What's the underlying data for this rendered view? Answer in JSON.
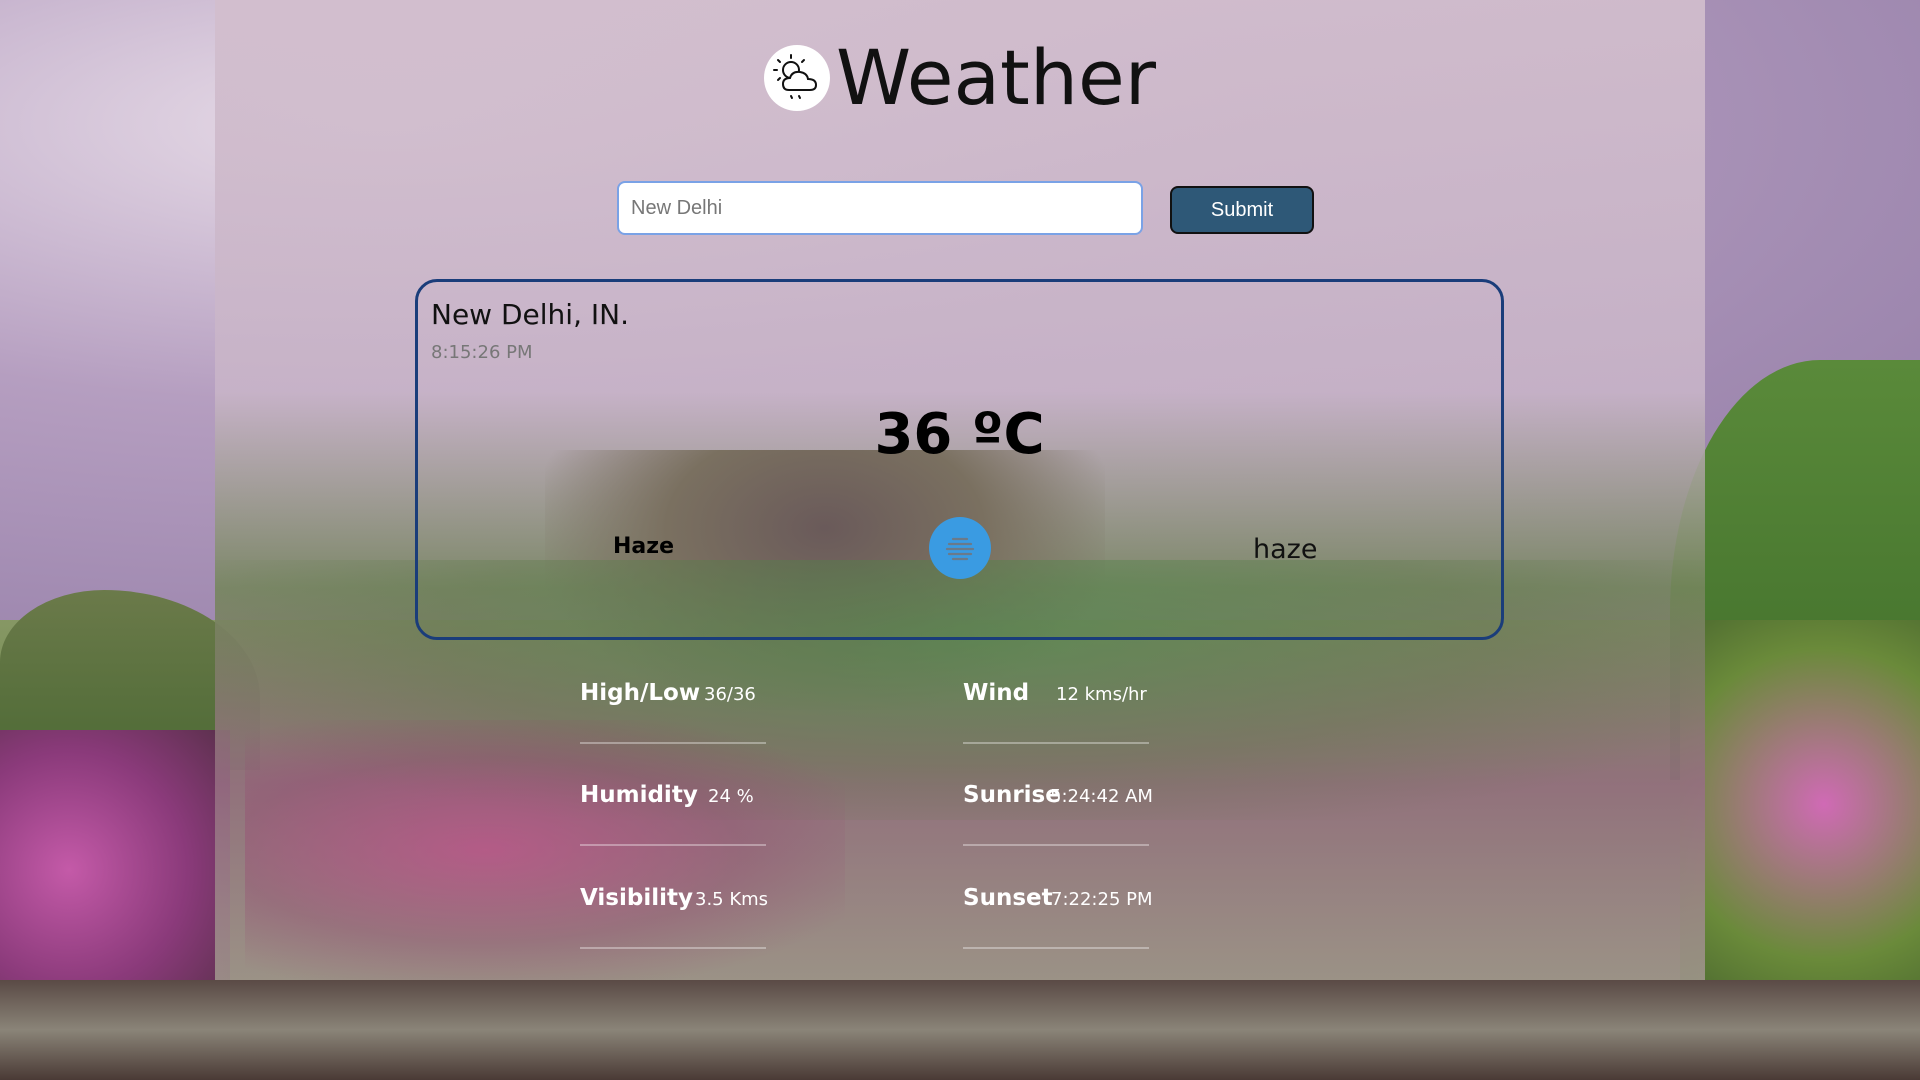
{
  "app": {
    "title": "Weather"
  },
  "search": {
    "value": "",
    "placeholder": "New Delhi",
    "submit_label": "Submit"
  },
  "current": {
    "location": "New Delhi, IN.",
    "time": "8:15:26 PM",
    "temperature": "36 ºC",
    "condition_main": "Haze",
    "condition_description": "haze",
    "condition_icon": "haze-icon"
  },
  "stats": {
    "high_low": {
      "label": "High/Low",
      "value": "36/36"
    },
    "humidity": {
      "label": "Humidity",
      "value": "24 %"
    },
    "visibility": {
      "label": "Visibility",
      "value": "3.5 Kms"
    },
    "wind": {
      "label": "Wind",
      "value": "12 kms/hr"
    },
    "sunrise": {
      "label": "Sunrise",
      "value": "5:24:42 AM"
    },
    "sunset": {
      "label": "Sunset",
      "value": "7:22:25 PM"
    }
  },
  "colors": {
    "submit_button": "#2e5877",
    "card_border": "#1a3d7a",
    "condition_icon_bg": "#3a9be2",
    "input_border": "#7aa2e6"
  }
}
